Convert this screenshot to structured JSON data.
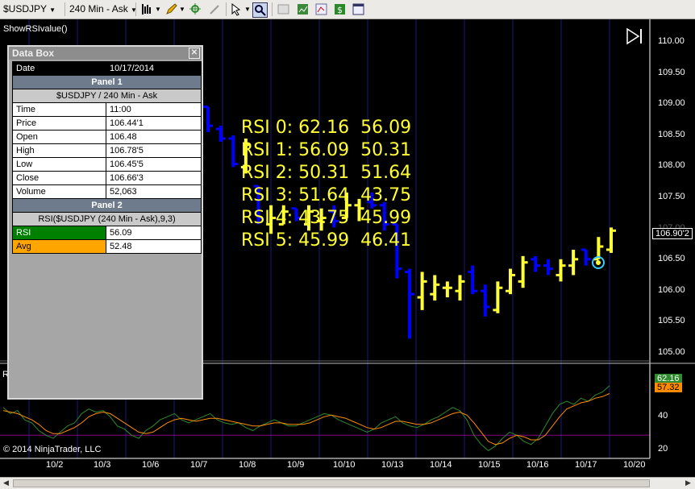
{
  "toolbar": {
    "instrument": "$USDJPY",
    "interval": "240 Min - Ask"
  },
  "indicator_name": "ShowRSIvalue()",
  "copyright": "© 2014 NinjaTrader, LLC",
  "panel2_short_label": "R",
  "databox": {
    "title": "Data Box",
    "date_label": "Date",
    "date_value": "10/17/2014",
    "panel1_title": "Panel 1",
    "panel1_series": "$USDJPY / 240 Min - Ask",
    "rows": [
      {
        "label": "Time",
        "value": "11:00"
      },
      {
        "label": "Price",
        "value": "106.44'1"
      },
      {
        "label": "Open",
        "value": "106.48"
      },
      {
        "label": "High",
        "value": "106.78'5"
      },
      {
        "label": "Low",
        "value": "106.45'5"
      },
      {
        "label": "Close",
        "value": "106.66'3"
      },
      {
        "label": "Volume",
        "value": "52,063"
      }
    ],
    "panel2_title": "Panel 2",
    "panel2_series": "RSI($USDJPY (240 Min - Ask),9,3)",
    "rsi_label": "RSI",
    "rsi_value": "56.09",
    "avg_label": "Avg",
    "avg_value": "52.48",
    "rsi_color": "#008000",
    "avg_color": "#ffa500"
  },
  "rsi_lines": [
    "RSI 0: 62.16  56.09",
    "RSI 1: 56.09  50.31",
    "RSI 2: 50.31  51.64",
    "RSI 3: 51.64  43.75",
    "RSI 4: 43.75  45.99",
    "RSI 5: 45.99  46.41"
  ],
  "price_axis": [
    "110.00",
    "109.50",
    "109.00",
    "108.50",
    "108.00",
    "107.50",
    "107.00",
    "106.50",
    "106.00",
    "105.50",
    "105.00"
  ],
  "current_price_tag": "106.90'2",
  "rsi_axis": [
    "40",
    "20"
  ],
  "rsi_tag": "62.16",
  "avg_tag": "57.32",
  "date_axis": [
    "10/2",
    "10/3",
    "10/6",
    "10/7",
    "10/8",
    "10/9",
    "10/10",
    "10/13",
    "10/14",
    "10/15",
    "10/16",
    "10/17",
    "10/20"
  ],
  "colors": {
    "up_bar": "#ffff33",
    "down_bar": "#0000ff",
    "session_line": "#1a1a80",
    "rsi_line": "#2e8b2e",
    "avg_line": "#ff8c00",
    "level_line": "#800080"
  },
  "chart_data": {
    "type": "ohlc",
    "instrument": "$USDJPY",
    "interval": "240 Min - Ask",
    "price_ylim": [
      104.9,
      110.1
    ],
    "bars": [
      {
        "o": 108.85,
        "h": 108.85,
        "l": 108.45,
        "c": 108.55,
        "dir": "down"
      },
      {
        "o": 108.5,
        "h": 108.55,
        "l": 108.3,
        "c": 108.35,
        "dir": "down"
      },
      {
        "o": 108.35,
        "h": 108.4,
        "l": 107.9,
        "c": 107.95,
        "dir": "down"
      },
      {
        "o": 107.9,
        "h": 108.35,
        "l": 107.8,
        "c": 108.25,
        "dir": "up"
      },
      {
        "o": 107.6,
        "h": 107.6,
        "l": 107.0,
        "c": 107.1,
        "dir": "down"
      },
      {
        "o": 107.0,
        "h": 107.3,
        "l": 106.85,
        "c": 107.1,
        "dir": "up"
      },
      {
        "o": 107.0,
        "h": 107.3,
        "l": 107.0,
        "c": 107.2,
        "dir": "up"
      },
      {
        "o": 107.25,
        "h": 107.25,
        "l": 107.05,
        "c": 107.1,
        "dir": "down"
      },
      {
        "o": 107.0,
        "h": 107.3,
        "l": 106.9,
        "c": 107.2,
        "dir": "up"
      },
      {
        "o": 107.05,
        "h": 107.25,
        "l": 106.9,
        "c": 107.1,
        "dir": "up"
      },
      {
        "o": 107.2,
        "h": 107.3,
        "l": 106.95,
        "c": 107.05,
        "dir": "down"
      },
      {
        "o": 107.1,
        "h": 107.5,
        "l": 107.1,
        "c": 107.3,
        "dir": "up"
      },
      {
        "o": 107.3,
        "h": 107.4,
        "l": 107.05,
        "c": 107.25,
        "dir": "up"
      },
      {
        "o": 107.35,
        "h": 107.5,
        "l": 107.25,
        "c": 107.3,
        "dir": "down"
      },
      {
        "o": 107.3,
        "h": 107.35,
        "l": 106.9,
        "c": 107.0,
        "dir": "down"
      },
      {
        "o": 107.0,
        "h": 107.0,
        "l": 106.15,
        "c": 106.3,
        "dir": "down"
      },
      {
        "o": 106.25,
        "h": 106.3,
        "l": 105.2,
        "c": 105.9,
        "dir": "down"
      },
      {
        "o": 105.85,
        "h": 106.25,
        "l": 105.65,
        "c": 106.1,
        "dir": "up"
      },
      {
        "o": 105.9,
        "h": 106.2,
        "l": 105.8,
        "c": 106.05,
        "dir": "up"
      },
      {
        "o": 106.0,
        "h": 106.1,
        "l": 105.85,
        "c": 106.0,
        "dir": "up"
      },
      {
        "o": 105.95,
        "h": 106.2,
        "l": 105.8,
        "c": 106.1,
        "dir": "up"
      },
      {
        "o": 106.25,
        "h": 106.35,
        "l": 105.9,
        "c": 105.95,
        "dir": "down"
      },
      {
        "o": 105.95,
        "h": 106.05,
        "l": 105.55,
        "c": 105.7,
        "dir": "down"
      },
      {
        "o": 105.65,
        "h": 106.1,
        "l": 105.6,
        "c": 106.0,
        "dir": "up"
      },
      {
        "o": 105.95,
        "h": 106.3,
        "l": 105.9,
        "c": 106.2,
        "dir": "up"
      },
      {
        "o": 106.1,
        "h": 106.5,
        "l": 106.0,
        "c": 106.4,
        "dir": "up"
      },
      {
        "o": 106.45,
        "h": 106.5,
        "l": 106.25,
        "c": 106.35,
        "dir": "down"
      },
      {
        "o": 106.35,
        "h": 106.45,
        "l": 106.2,
        "c": 106.3,
        "dir": "down"
      },
      {
        "o": 106.2,
        "h": 106.45,
        "l": 106.1,
        "c": 106.35,
        "dir": "up"
      },
      {
        "o": 106.35,
        "h": 106.6,
        "l": 106.2,
        "c": 106.45,
        "dir": "up"
      },
      {
        "o": 106.6,
        "h": 106.6,
        "l": 106.35,
        "c": 106.45,
        "dir": "down"
      },
      {
        "o": 106.45,
        "h": 106.8,
        "l": 106.45,
        "c": 106.65,
        "dir": "up"
      },
      {
        "o": 106.6,
        "h": 106.95,
        "l": 106.55,
        "c": 106.9,
        "dir": "up"
      }
    ],
    "rsi_ylim": [
      15,
      75
    ],
    "rsi_level": 30,
    "rsi_series": [
      48,
      44,
      46,
      40,
      38,
      33,
      30,
      28,
      32,
      36,
      38,
      44,
      47,
      45,
      46,
      42,
      36,
      34,
      30,
      28,
      33,
      36,
      40,
      42,
      44,
      40,
      38,
      40,
      42,
      44,
      40,
      38,
      37,
      38,
      35,
      33,
      36,
      38,
      40,
      38,
      36,
      36,
      38,
      40,
      42,
      44,
      43,
      40,
      38,
      36,
      34,
      32,
      34,
      38,
      40,
      42,
      38,
      36,
      35,
      37,
      40,
      42,
      45,
      48,
      46,
      40,
      30,
      24,
      20,
      23,
      28,
      32,
      30,
      26,
      24,
      28,
      36,
      44,
      50,
      52,
      50,
      54,
      52,
      56,
      58,
      62
    ],
    "avg_series": [
      46,
      45,
      44,
      42,
      40,
      37,
      33,
      31,
      31,
      33,
      35,
      38,
      42,
      44,
      45,
      44,
      41,
      38,
      35,
      32,
      31,
      32,
      35,
      38,
      40,
      41,
      40,
      39,
      40,
      41,
      41,
      40,
      39,
      38,
      37,
      36,
      36,
      37,
      38,
      38,
      37,
      37,
      37,
      38,
      40,
      42,
      43,
      42,
      41,
      39,
      37,
      35,
      34,
      35,
      37,
      39,
      39,
      38,
      37,
      37,
      38,
      40,
      42,
      44,
      45,
      43,
      38,
      32,
      26,
      24,
      25,
      28,
      30,
      29,
      27,
      27,
      30,
      36,
      42,
      47,
      49,
      51,
      52,
      54,
      55,
      57
    ]
  }
}
